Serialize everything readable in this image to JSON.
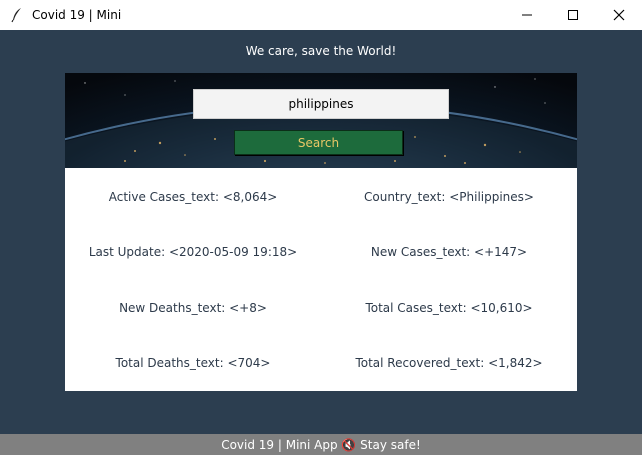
{
  "window": {
    "title": "Covid 19 | Mini",
    "icon": "feather-icon",
    "controls": [
      "minimize-icon",
      "maximize-icon",
      "close-icon"
    ]
  },
  "header": {
    "tagline": "We care, save the World!"
  },
  "search": {
    "value": "philippines",
    "button_label": "Search"
  },
  "stats": {
    "active_cases": "Active Cases_text: <8,064>",
    "country": "Country_text: <Philippines>",
    "last_update": "Last Update: <2020-05-09 19:18>",
    "new_cases": "New Cases_text: <+147>",
    "new_deaths": "New Deaths_text: <+8>",
    "total_cases": "Total Cases_text: <10,610>",
    "total_deaths": "Total Deaths_text: <704>",
    "total_recovered": "Total Recovered_text: <1,842>"
  },
  "footer": {
    "status": "Covid 19 | Mini App 🔇 Stay safe!"
  },
  "colors": {
    "background": "#2c3e50",
    "button": "#1d6b3c",
    "button_text": "#e8c766",
    "statusbar": "#808080"
  }
}
